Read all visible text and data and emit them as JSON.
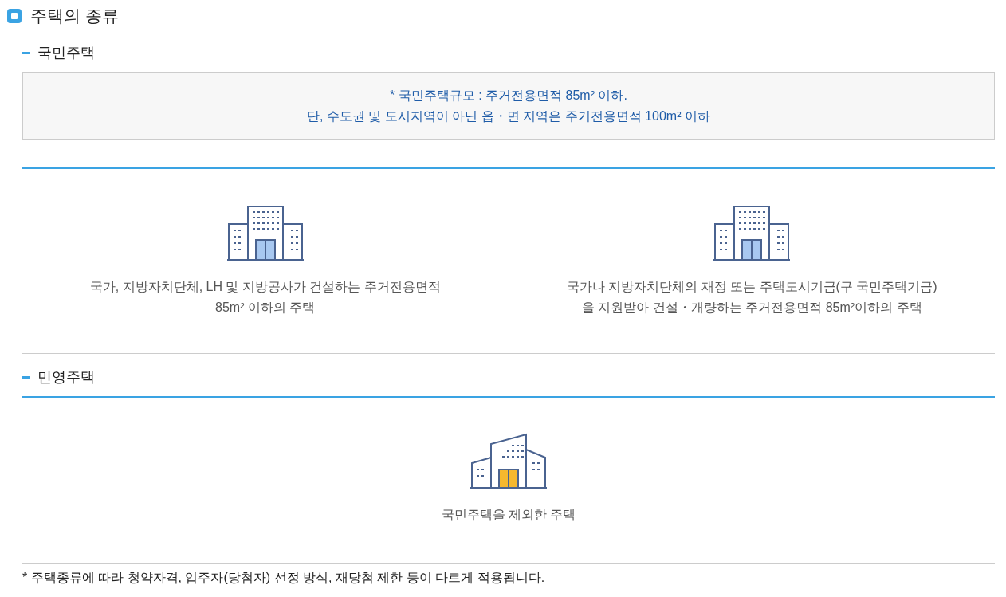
{
  "title": "주택의 종류",
  "sections": [
    {
      "heading": "국민주택",
      "notice": [
        "* 국민주택규모 : 주거전용면적 85m² 이하.",
        "단, 수도권 및 도시지역이 아닌 읍・면 지역은 주거전용면적 100m² 이하"
      ],
      "items": [
        {
          "kind": "public",
          "lines": [
            "국가, 지방자치단체, LH 및 지방공사가 건설하는 주거전용면적",
            "85m² 이하의 주택"
          ]
        },
        {
          "kind": "public",
          "lines": [
            "국가나 지방자치단체의 재정 또는 주택도시기금(구 국민주택기금)",
            "을 지원받아 건설・개량하는 주거전용면적 85m²이하의 주택"
          ]
        }
      ]
    },
    {
      "heading": "민영주택",
      "items": [
        {
          "kind": "private",
          "lines": [
            "국민주택을 제외한 주택"
          ]
        }
      ]
    }
  ],
  "footnote": "* 주택종류에 따라 청약자격, 입주자(당첨자) 선정 방식, 재당첨 제한 등이 다르게 적용됩니다."
}
